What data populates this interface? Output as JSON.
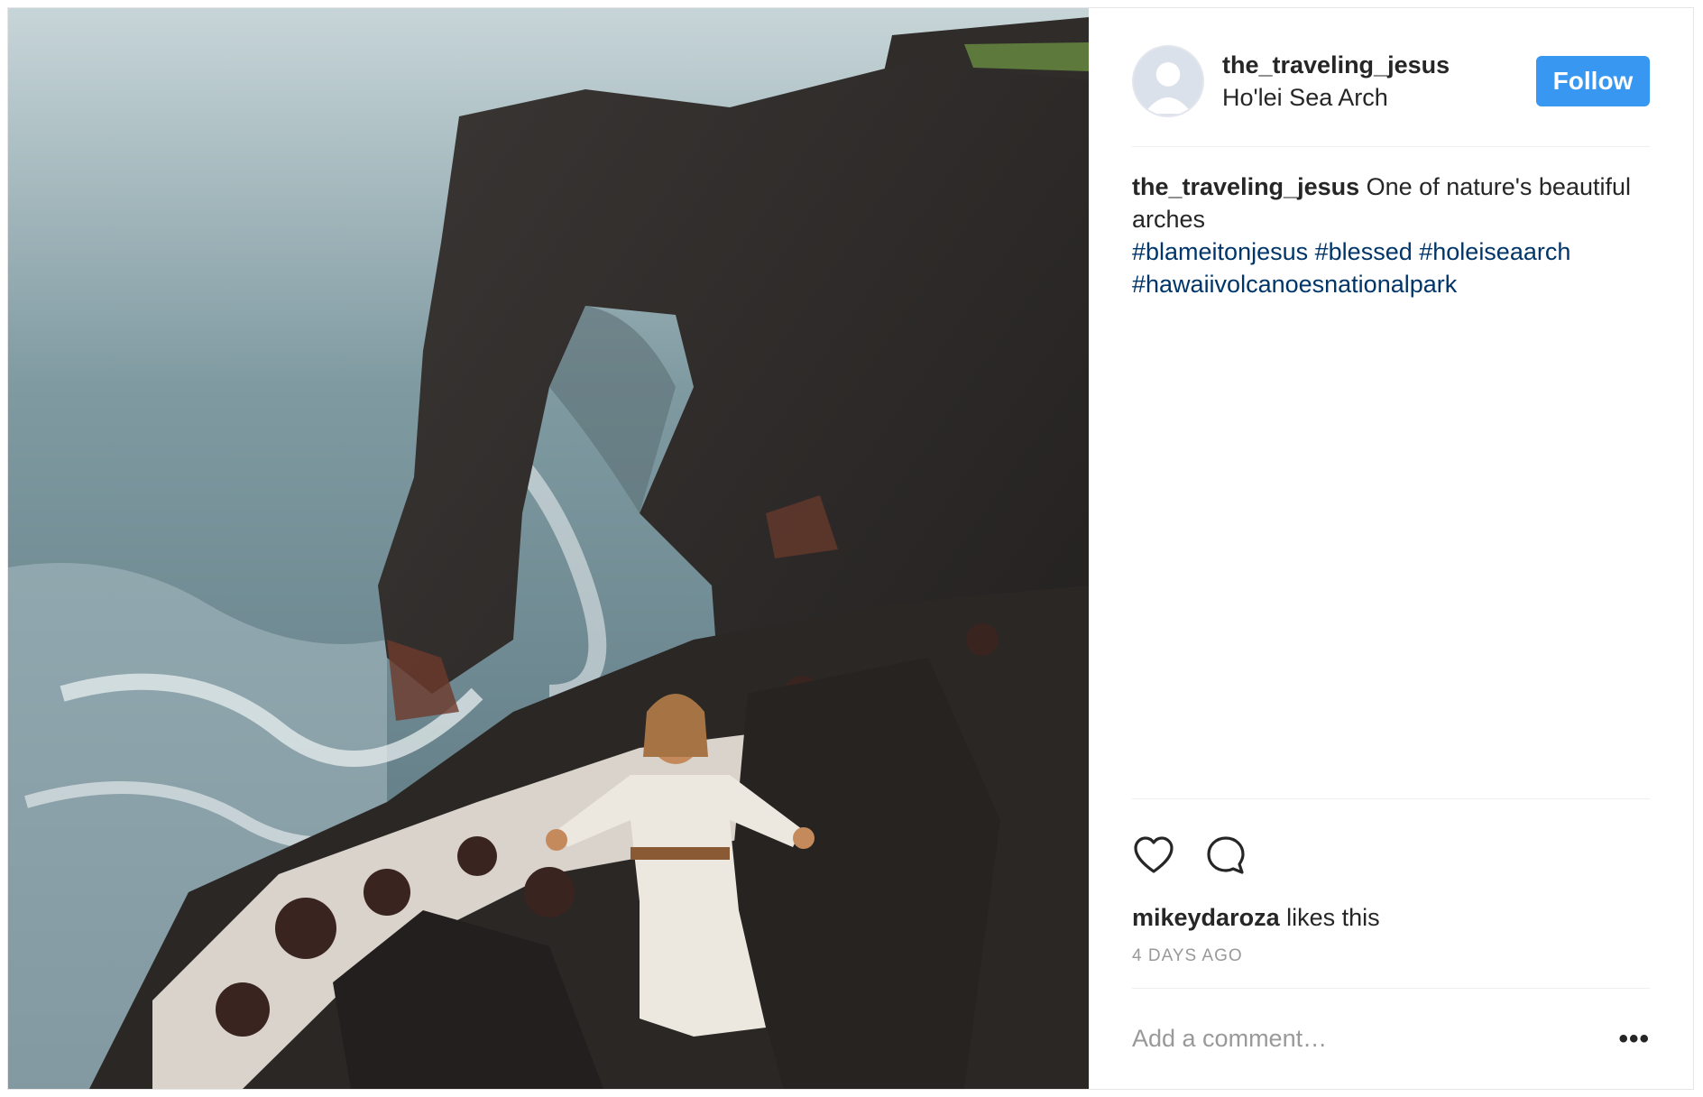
{
  "post": {
    "username": "the_traveling_jesus",
    "location": "Ho'lei Sea Arch",
    "follow_label": "Follow",
    "caption": {
      "username": "the_traveling_jesus",
      "text": "One of nature's beautiful arches",
      "hashtags": [
        "#blameitonjesus",
        "#blessed",
        "#holeiseaarch",
        "#hawaiivolcanoesnationalpark"
      ]
    },
    "likes": {
      "liker": "mikeydaroza",
      "suffix": "likes this"
    },
    "timestamp": "4 DAYS AGO",
    "comment_placeholder": "Add a comment…",
    "more_label": "•••"
  },
  "icons": {
    "like": "heart-icon",
    "comment": "comment-bubble-icon",
    "avatar": "default-avatar-icon"
  },
  "colors": {
    "follow_button": "#3897f0",
    "hashtag": "#003569",
    "muted": "#999999",
    "border": "#efefef"
  }
}
